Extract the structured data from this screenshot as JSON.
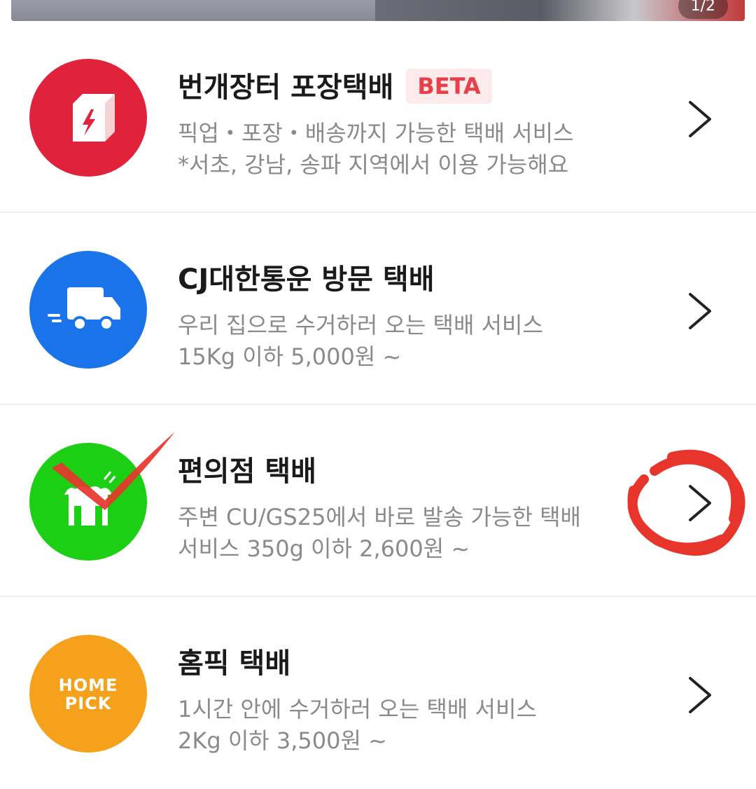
{
  "banner": {
    "counter": "1/2"
  },
  "services": [
    {
      "title": "번개장터 포장택배",
      "badge": "BETA",
      "desc_line1": "픽업・포장・배송까지 가능한 택배 서비스",
      "desc_line2": "*서초, 강남, 송파 지역에서 이용 가능해요",
      "icon": "box-lightning-icon",
      "color": "#e0223a"
    },
    {
      "title": "CJ대한통운 방문 택배",
      "desc_line1": "우리 집으로 수거하러 오는 택배 서비스",
      "desc_line2": "15Kg 이하 5,000원 ~",
      "icon": "delivery-truck-icon",
      "color": "#1a73e8"
    },
    {
      "title": "편의점 택배",
      "desc_line1": "주변 CU/GS25에서 바로 발송 가능한 택배",
      "desc_line2": "서비스 350g 이하 2,600원 ~",
      "icon": "convenience-store-icon",
      "color": "#1dcf14"
    },
    {
      "title": "홈픽 택배",
      "desc_line1": "1시간 안에 수거하러 오는 택배 서비스",
      "desc_line2": "2Kg 이하 3,500원 ~",
      "icon": "homepick-logo",
      "logo_text_line1": "HOME",
      "logo_text_line2": "PICK",
      "color": "#f5a11c"
    }
  ],
  "annotations": {
    "checkmark_color": "#e8352c",
    "circle_color": "#e8352c"
  }
}
